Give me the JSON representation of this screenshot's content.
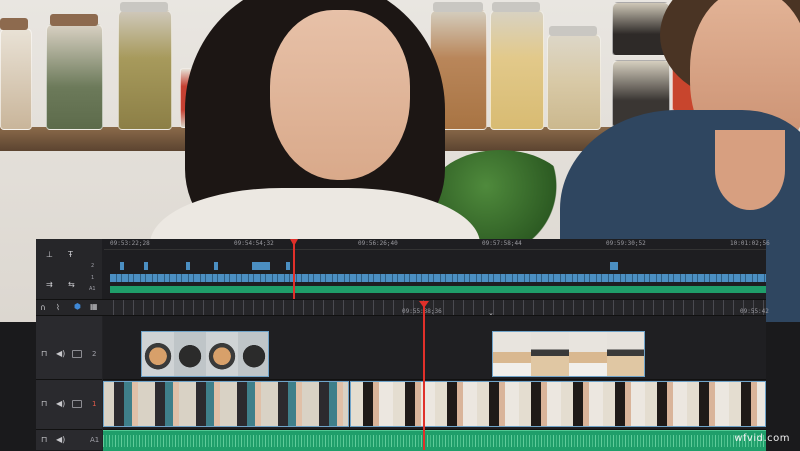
{
  "timeline": {
    "top_ruler": [
      "09:53:22;28",
      "09:54:54;32",
      "09:56:26;40",
      "09:57:58;44",
      "09:59:30;52",
      "10:01:02;56"
    ],
    "playhead_timecode": "09:55:38;36",
    "bottom_ruler_right": "09:55:42",
    "mini_track_labels": [
      "2",
      "1",
      "A1"
    ],
    "tracks": [
      {
        "id": "2"
      },
      {
        "id": "1"
      },
      {
        "id": "A1"
      }
    ]
  },
  "watermark": "wfvid.com",
  "colors": {
    "video_track": "#4b8fc2",
    "audio_track": "#1f9e6a",
    "playhead": "#e0302a",
    "clip_border": "#6fa3c9"
  },
  "icons": {
    "top_tools": [
      "trim-icon",
      "text-icon",
      "link-icon",
      "swap-icon"
    ],
    "bar_tools": [
      "magnet-icon",
      "blade-icon",
      "flag-icon",
      "grid-icon"
    ],
    "track_controls": [
      "lock-icon",
      "speaker-icon",
      "monitor-icon"
    ]
  }
}
